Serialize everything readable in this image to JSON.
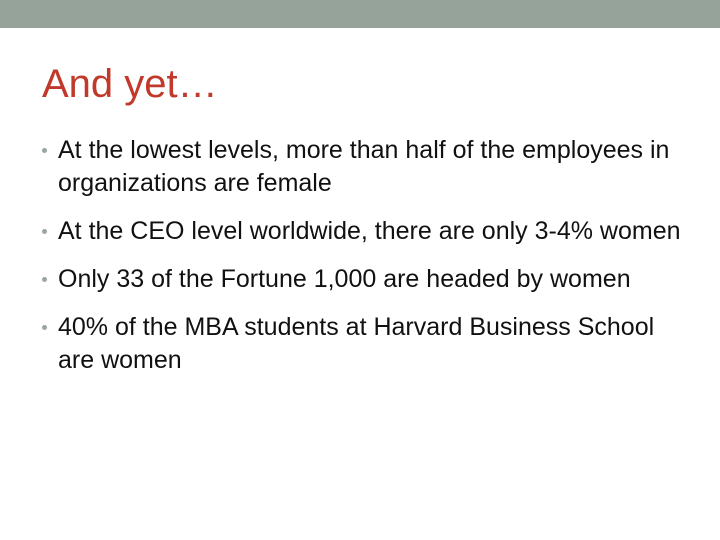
{
  "slide": {
    "title": "And yet…",
    "bullets": [
      "At the lowest levels, more than half of the employees in organizations are female",
      "At the CEO level worldwide, there are only 3-4% women",
      "Only 33 of the Fortune 1,000 are headed by women",
      "40% of the MBA students at Harvard Business School are women"
    ]
  },
  "colors": {
    "top_band": "#95a39a",
    "title": "#c0392b",
    "body_text": "#111111",
    "bullet_marker": "#9aa59c"
  }
}
